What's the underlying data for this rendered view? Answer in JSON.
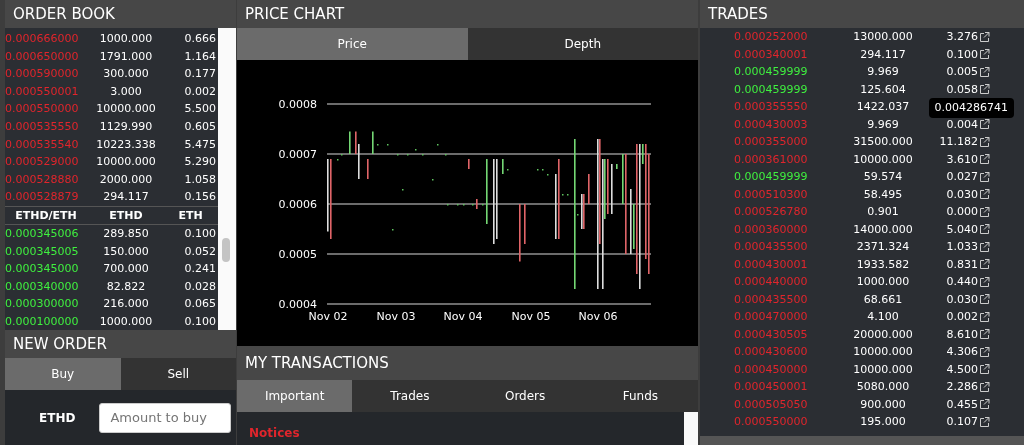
{
  "order_book": {
    "title": "ORDER BOOK",
    "asks": [
      {
        "price": "0.000666000",
        "amount": "1000.000",
        "total": "0.666"
      },
      {
        "price": "0.000650000",
        "amount": "1791.000",
        "total": "1.164"
      },
      {
        "price": "0.000590000",
        "amount": "300.000",
        "total": "0.177"
      },
      {
        "price": "0.000550001",
        "amount": "3.000",
        "total": "0.002"
      },
      {
        "price": "0.000550000",
        "amount": "10000.000",
        "total": "5.500"
      },
      {
        "price": "0.000535550",
        "amount": "1129.990",
        "total": "0.605"
      },
      {
        "price": "0.000535540",
        "amount": "10223.338",
        "total": "5.475"
      },
      {
        "price": "0.000529000",
        "amount": "10000.000",
        "total": "5.290"
      },
      {
        "price": "0.000528880",
        "amount": "2000.000",
        "total": "1.058"
      },
      {
        "price": "0.000528879",
        "amount": "294.117",
        "total": "0.156"
      }
    ],
    "columns": [
      "ETHD/ETH",
      "ETHD",
      "ETH"
    ],
    "bids": [
      {
        "price": "0.000345006",
        "amount": "289.850",
        "total": "0.100"
      },
      {
        "price": "0.000345005",
        "amount": "150.000",
        "total": "0.052"
      },
      {
        "price": "0.000345000",
        "amount": "700.000",
        "total": "0.241"
      },
      {
        "price": "0.000340000",
        "amount": "82.822",
        "total": "0.028"
      },
      {
        "price": "0.000300000",
        "amount": "216.000",
        "total": "0.065"
      },
      {
        "price": "0.000100000",
        "amount": "1000.000",
        "total": "0.100"
      }
    ]
  },
  "new_order": {
    "title": "NEW ORDER",
    "tabs": [
      {
        "label": "Buy",
        "selected": true
      },
      {
        "label": "Sell",
        "selected": false
      }
    ],
    "field_label": "ETHD",
    "placeholder": "Amount to buy"
  },
  "price_chart": {
    "title": "PRICE CHART",
    "tabs": [
      {
        "label": "Price",
        "selected": true
      },
      {
        "label": "Depth",
        "selected": false
      }
    ],
    "y_ticks": [
      "0.0008",
      "0.0007",
      "0.0006",
      "0.0005",
      "0.0004"
    ],
    "x_labels": [
      "Nov 02",
      "Nov 03",
      "Nov 04",
      "Nov 05",
      "Nov 06"
    ]
  },
  "my_transactions": {
    "title": "MY TRANSACTIONS",
    "tabs": [
      {
        "label": "Important",
        "selected": true
      },
      {
        "label": "Trades",
        "selected": false
      },
      {
        "label": "Orders",
        "selected": false
      },
      {
        "label": "Funds",
        "selected": false
      }
    ],
    "section": "Notices"
  },
  "trades": {
    "title": "TRADES",
    "rows": [
      {
        "color": "#e0252c",
        "price": "0.000252000",
        "amount": "13000.000",
        "total": "3.276"
      },
      {
        "color": "#e0252c",
        "price": "0.000340001",
        "amount": "294.117",
        "total": "0.100"
      },
      {
        "color": "#3ff03f",
        "price": "0.000459999",
        "amount": "9.969",
        "total": "0.005"
      },
      {
        "color": "#3ff03f",
        "price": "0.000459999",
        "amount": "125.604",
        "total": "0.058"
      },
      {
        "color": "#e0252c",
        "price": "0.000355550",
        "amount": "1422.037",
        "tooltip": "0.004286741"
      },
      {
        "color": "#e0252c",
        "price": "0.000430003",
        "amount": "9.969",
        "total": "0.004"
      },
      {
        "color": "#e0252c",
        "price": "0.000355000",
        "amount": "31500.000",
        "total": "11.182"
      },
      {
        "color": "#e0252c",
        "price": "0.000361000",
        "amount": "10000.000",
        "total": "3.610"
      },
      {
        "color": "#3ff03f",
        "price": "0.000459999",
        "amount": "59.574",
        "total": "0.027"
      },
      {
        "color": "#e0252c",
        "price": "0.000510300",
        "amount": "58.495",
        "total": "0.030"
      },
      {
        "color": "#e0252c",
        "price": "0.000526780",
        "amount": "0.901",
        "total": "0.000"
      },
      {
        "color": "#e0252c",
        "price": "0.000360000",
        "amount": "14000.000",
        "total": "5.040"
      },
      {
        "color": "#e0252c",
        "price": "0.000435500",
        "amount": "2371.324",
        "total": "1.033"
      },
      {
        "color": "#e0252c",
        "price": "0.000430001",
        "amount": "1933.582",
        "total": "0.831"
      },
      {
        "color": "#e0252c",
        "price": "0.000440000",
        "amount": "1000.000",
        "total": "0.440"
      },
      {
        "color": "#e0252c",
        "price": "0.000435500",
        "amount": "68.661",
        "total": "0.030"
      },
      {
        "color": "#e0252c",
        "price": "0.000470000",
        "amount": "4.100",
        "total": "0.002"
      },
      {
        "color": "#e0252c",
        "price": "0.000430505",
        "amount": "20000.000",
        "total": "8.610"
      },
      {
        "color": "#e0252c",
        "price": "0.000430600",
        "amount": "10000.000",
        "total": "4.306"
      },
      {
        "color": "#e0252c",
        "price": "0.000450000",
        "amount": "10000.000",
        "total": "4.500"
      },
      {
        "color": "#e0252c",
        "price": "0.000450001",
        "amount": "5080.000",
        "total": "2.286"
      },
      {
        "color": "#e0252c",
        "price": "0.000505050",
        "amount": "900.000",
        "total": "0.455"
      },
      {
        "color": "#e0252c",
        "price": "0.000550000",
        "amount": "195.000",
        "total": "0.107"
      }
    ]
  }
}
